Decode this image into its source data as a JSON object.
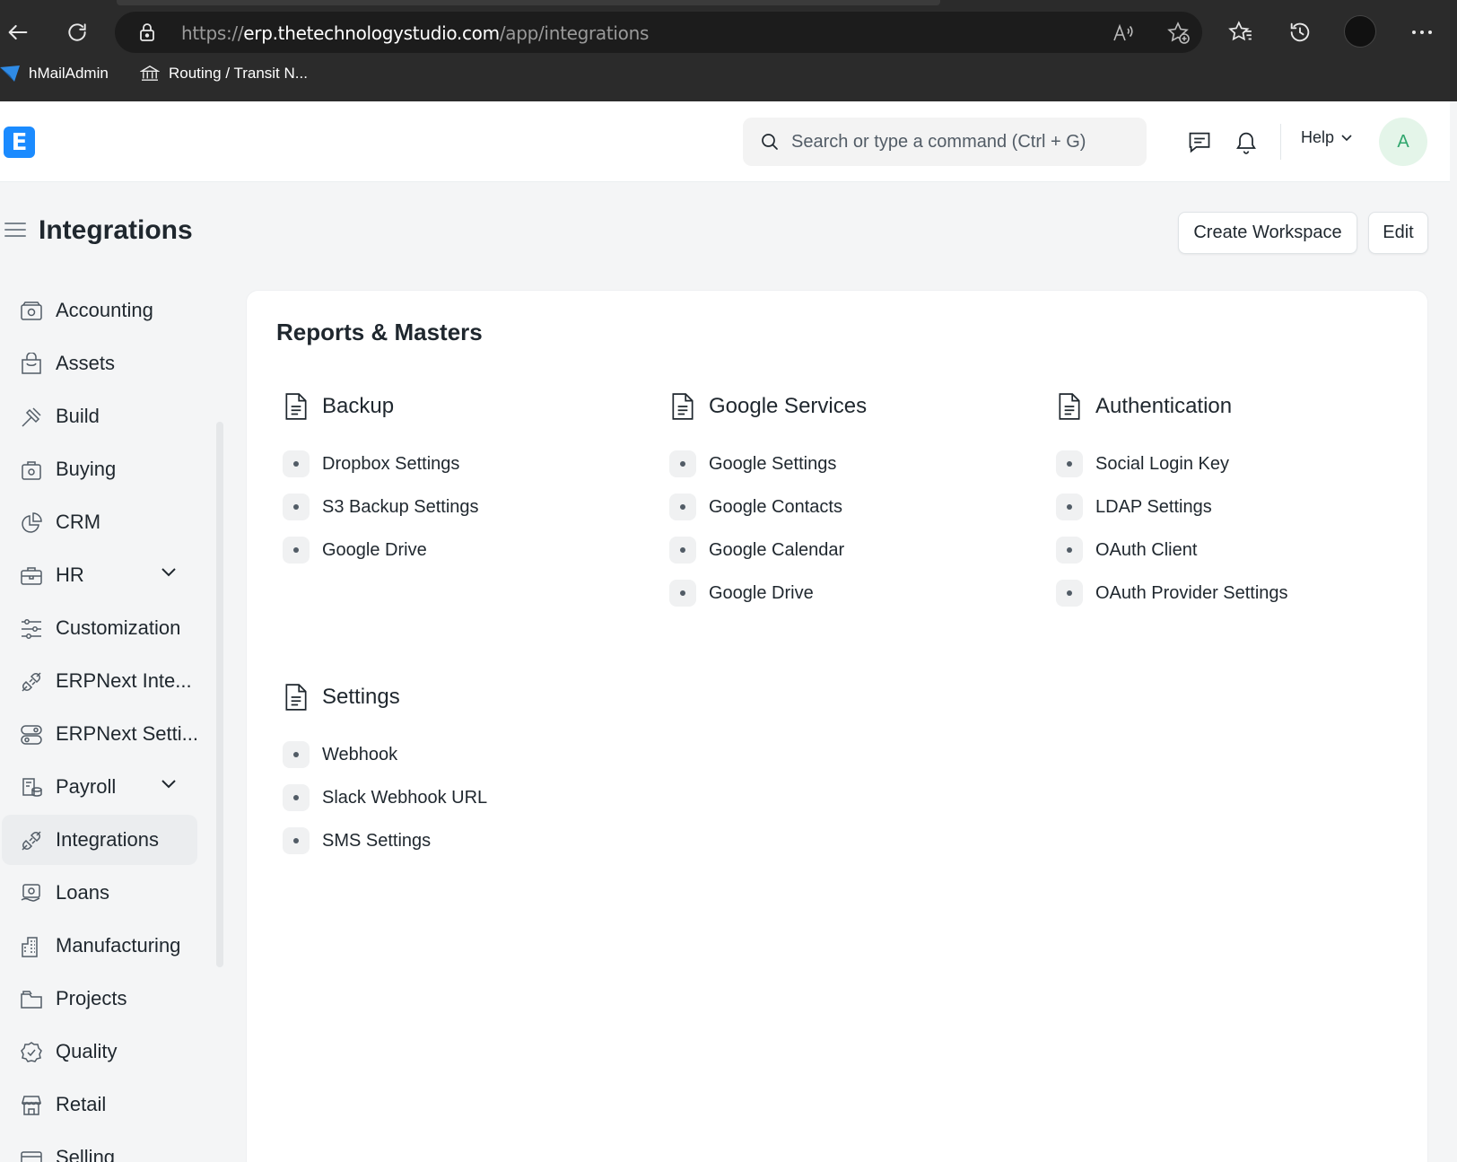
{
  "browser": {
    "url_prefix": "https://",
    "url_host": "erp.thetechnologystudio.com",
    "url_path": "/app/integrations",
    "bookmarks": [
      {
        "label": "hMailAdmin"
      },
      {
        "label": "Routing / Transit N..."
      }
    ]
  },
  "navbar": {
    "logo_letter": "E",
    "search_placeholder": "Search or type a command (Ctrl + G)",
    "help_label": "Help",
    "avatar_letter": "A"
  },
  "page": {
    "title": "Integrations",
    "create_workspace_label": "Create Workspace",
    "edit_label": "Edit"
  },
  "sidebar": {
    "items": [
      {
        "label": "Accounting",
        "icon": "accounting-icon"
      },
      {
        "label": "Assets",
        "icon": "assets-icon"
      },
      {
        "label": "Build",
        "icon": "build-icon"
      },
      {
        "label": "Buying",
        "icon": "buying-icon"
      },
      {
        "label": "CRM",
        "icon": "crm-icon"
      },
      {
        "label": "HR",
        "icon": "hr-icon",
        "expandable": true
      },
      {
        "label": "Customization",
        "icon": "customization-icon"
      },
      {
        "label": "ERPNext Inte...",
        "icon": "integration-icon"
      },
      {
        "label": "ERPNext Setti...",
        "icon": "settings-icon"
      },
      {
        "label": "Payroll",
        "icon": "payroll-icon",
        "expandable": true
      },
      {
        "label": "Integrations",
        "icon": "integration-icon",
        "active": true
      },
      {
        "label": "Loans",
        "icon": "loans-icon"
      },
      {
        "label": "Manufacturing",
        "icon": "manufacturing-icon"
      },
      {
        "label": "Projects",
        "icon": "projects-icon"
      },
      {
        "label": "Quality",
        "icon": "quality-icon"
      },
      {
        "label": "Retail",
        "icon": "retail-icon"
      },
      {
        "label": "Selling",
        "icon": "selling-icon"
      }
    ]
  },
  "main": {
    "section_title": "Reports & Masters",
    "groups": [
      {
        "title": "Backup",
        "links": [
          "Dropbox Settings",
          "S3 Backup Settings",
          "Google Drive"
        ]
      },
      {
        "title": "Google Services",
        "links": [
          "Google Settings",
          "Google Contacts",
          "Google Calendar",
          "Google Drive"
        ]
      },
      {
        "title": "Authentication",
        "links": [
          "Social Login Key",
          "LDAP Settings",
          "OAuth Client",
          "OAuth Provider Settings"
        ]
      },
      {
        "title": "Settings",
        "links": [
          "Webhook",
          "Slack Webhook URL",
          "SMS Settings"
        ]
      }
    ]
  }
}
